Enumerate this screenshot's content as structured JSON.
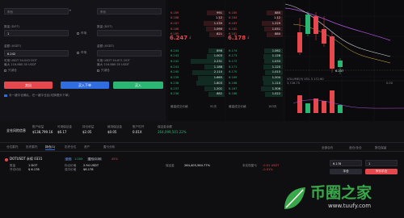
{
  "order_form": {
    "left": {
      "price_placeholder": "市价",
      "qty_label": "数量 (DOT)",
      "qty_value": "1",
      "slider_label": "市场",
      "amount_label": "金额 (USDT)",
      "amount_value": "6.242",
      "avail_label": "可用 USDT 54.043 DOT",
      "max_label": "最大 116.880.35 USDT",
      "checkbox_label": "只减仓",
      "tpsl_label": "市场"
    },
    "right": {
      "price_placeholder": "市价",
      "qty_label": "数量 (DOT)",
      "amount_label": "金额 (USDT)",
      "avail_label": "可用 USDT 54.671 DOT",
      "max_label": "最大 116.880.35 USDT",
      "checkbox_label": "只减仓",
      "tpsl_label": "市场"
    },
    "sell_button": "卖出",
    "buy_button": "买入下单",
    "confirm_button": "买入",
    "agree_text": "对一键平仓确认，在一键平仓区(切换限价下单)"
  },
  "orderbook_left": {
    "asks": [
      [
        "6.189",
        "991"
      ],
      [
        "6.188",
        "1.12"
      ],
      [
        "6.187",
        "1.239"
      ],
      [
        "6.186",
        "1.090"
      ],
      [
        "6.185",
        "821"
      ]
    ],
    "mid_price": "6.247",
    "mid_arrow": "↓",
    "bids": [
      [
        "6.244",
        "898"
      ],
      [
        "6.243",
        "1.003"
      ],
      [
        "6.242",
        "2.231"
      ],
      [
        "6.241",
        "1.188"
      ],
      [
        "6.240",
        "2.110"
      ],
      [
        "6.239",
        "1.665"
      ],
      [
        "6.238",
        "1.803"
      ],
      [
        "6.237",
        "1.201"
      ],
      [
        "6.236",
        "882"
      ]
    ],
    "footer_left": "最高成交价格",
    "footer_right": "92天"
  },
  "orderbook_right": {
    "asks": [
      [
        "6.185",
        "885"
      ],
      [
        "6.184",
        "1.12"
      ],
      [
        "6.183",
        "1.229"
      ],
      [
        "6.182",
        "1.051"
      ],
      [
        "6.181",
        "880"
      ]
    ],
    "mid_price": "6.178",
    "mid_arrow": "↓",
    "bids": [
      [
        "6.174",
        "1.062"
      ],
      [
        "6.173",
        "1.128"
      ],
      [
        "6.172",
        "1.033"
      ],
      [
        "6.171",
        "1.120"
      ],
      [
        "6.170",
        "1.015"
      ],
      [
        "6.169",
        "1.204"
      ],
      [
        "6.168",
        "1.110"
      ],
      [
        "6.167",
        "1.306"
      ],
      [
        "6.166",
        "1.022"
      ]
    ],
    "footer_left": "最高成交价格",
    "footer_right": "183天"
  },
  "chart_panel": {
    "last_price_label": "6.237",
    "volume_label": "VOLUME(9)  VOL  3 172.60",
    "vol_left": "3,728.75",
    "vol_right": "0.00"
  },
  "summary": {
    "title": "全仓风险信息",
    "items": [
      {
        "label": "账户权益",
        "value": "$138,799.16"
      },
      {
        "label": "可用保证金",
        "value": "$6.17"
      },
      {
        "label": "持仓收益",
        "value": "$2.05"
      },
      {
        "label": "维持保证金",
        "value": "$0.05"
      },
      {
        "label": "账户杠杆",
        "value": "0.01X"
      },
      {
        "label": "保证金余额",
        "value": "264,099,501.22%"
      }
    ]
  },
  "tabs": [
    {
      "label": "仓位委托"
    },
    {
      "label": "历史委托"
    },
    {
      "label": "持仓(1)"
    },
    {
      "label": "历史仓位"
    },
    {
      "label": "资产"
    },
    {
      "label": "盈亏分析"
    }
  ],
  "tabs_right": {
    "filter1": "全部合约",
    "filter2": "逐仓/全仓",
    "filter3": "数位保留"
  },
  "position": {
    "symbol": "DOTUSDT 永续 0331",
    "tag1": "全仓",
    "tag2": "1.00X",
    "tag3": "盈亏:0.50",
    "tag4": "45%",
    "qty_label": "数量",
    "qty_value": "1 DOT",
    "entry_label": "开仓均价",
    "entry_value": "$ 6.178",
    "mark_label": "标记价格",
    "mark_value": "2.94 USDT",
    "liq_label": "强平价格",
    "liq_value": "$6.178",
    "margin_label": "保证金",
    "margin_value": "264,405,564.77%",
    "pnl_label": "未实现盈亏",
    "pnl_value": "-0.01 USDT",
    "pnl_pct": "-0.01%",
    "close_input": "6.178",
    "close_qty": "1",
    "limit_btn": "平仓",
    "market_btn": "市价平仓"
  },
  "watermark": {
    "text": "币圈之家",
    "url": "www.tuufy.com"
  },
  "colors": {
    "red": "#e5484d",
    "green": "#2bb673",
    "blue": "#2f6de1",
    "bg": "#0f0f12"
  }
}
